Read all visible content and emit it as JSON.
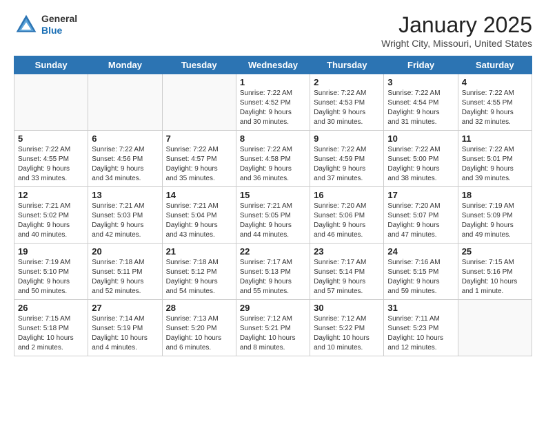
{
  "header": {
    "logo": {
      "general": "General",
      "blue": "Blue"
    },
    "title": "January 2025",
    "subtitle": "Wright City, Missouri, United States"
  },
  "weekdays": [
    "Sunday",
    "Monday",
    "Tuesday",
    "Wednesday",
    "Thursday",
    "Friday",
    "Saturday"
  ],
  "weeks": [
    [
      {
        "date": "",
        "info": ""
      },
      {
        "date": "",
        "info": ""
      },
      {
        "date": "",
        "info": ""
      },
      {
        "date": "1",
        "info": "Sunrise: 7:22 AM\nSunset: 4:52 PM\nDaylight: 9 hours\nand 30 minutes."
      },
      {
        "date": "2",
        "info": "Sunrise: 7:22 AM\nSunset: 4:53 PM\nDaylight: 9 hours\nand 30 minutes."
      },
      {
        "date": "3",
        "info": "Sunrise: 7:22 AM\nSunset: 4:54 PM\nDaylight: 9 hours\nand 31 minutes."
      },
      {
        "date": "4",
        "info": "Sunrise: 7:22 AM\nSunset: 4:55 PM\nDaylight: 9 hours\nand 32 minutes."
      }
    ],
    [
      {
        "date": "5",
        "info": "Sunrise: 7:22 AM\nSunset: 4:55 PM\nDaylight: 9 hours\nand 33 minutes."
      },
      {
        "date": "6",
        "info": "Sunrise: 7:22 AM\nSunset: 4:56 PM\nDaylight: 9 hours\nand 34 minutes."
      },
      {
        "date": "7",
        "info": "Sunrise: 7:22 AM\nSunset: 4:57 PM\nDaylight: 9 hours\nand 35 minutes."
      },
      {
        "date": "8",
        "info": "Sunrise: 7:22 AM\nSunset: 4:58 PM\nDaylight: 9 hours\nand 36 minutes."
      },
      {
        "date": "9",
        "info": "Sunrise: 7:22 AM\nSunset: 4:59 PM\nDaylight: 9 hours\nand 37 minutes."
      },
      {
        "date": "10",
        "info": "Sunrise: 7:22 AM\nSunset: 5:00 PM\nDaylight: 9 hours\nand 38 minutes."
      },
      {
        "date": "11",
        "info": "Sunrise: 7:22 AM\nSunset: 5:01 PM\nDaylight: 9 hours\nand 39 minutes."
      }
    ],
    [
      {
        "date": "12",
        "info": "Sunrise: 7:21 AM\nSunset: 5:02 PM\nDaylight: 9 hours\nand 40 minutes."
      },
      {
        "date": "13",
        "info": "Sunrise: 7:21 AM\nSunset: 5:03 PM\nDaylight: 9 hours\nand 42 minutes."
      },
      {
        "date": "14",
        "info": "Sunrise: 7:21 AM\nSunset: 5:04 PM\nDaylight: 9 hours\nand 43 minutes."
      },
      {
        "date": "15",
        "info": "Sunrise: 7:21 AM\nSunset: 5:05 PM\nDaylight: 9 hours\nand 44 minutes."
      },
      {
        "date": "16",
        "info": "Sunrise: 7:20 AM\nSunset: 5:06 PM\nDaylight: 9 hours\nand 46 minutes."
      },
      {
        "date": "17",
        "info": "Sunrise: 7:20 AM\nSunset: 5:07 PM\nDaylight: 9 hours\nand 47 minutes."
      },
      {
        "date": "18",
        "info": "Sunrise: 7:19 AM\nSunset: 5:09 PM\nDaylight: 9 hours\nand 49 minutes."
      }
    ],
    [
      {
        "date": "19",
        "info": "Sunrise: 7:19 AM\nSunset: 5:10 PM\nDaylight: 9 hours\nand 50 minutes."
      },
      {
        "date": "20",
        "info": "Sunrise: 7:18 AM\nSunset: 5:11 PM\nDaylight: 9 hours\nand 52 minutes."
      },
      {
        "date": "21",
        "info": "Sunrise: 7:18 AM\nSunset: 5:12 PM\nDaylight: 9 hours\nand 54 minutes."
      },
      {
        "date": "22",
        "info": "Sunrise: 7:17 AM\nSunset: 5:13 PM\nDaylight: 9 hours\nand 55 minutes."
      },
      {
        "date": "23",
        "info": "Sunrise: 7:17 AM\nSunset: 5:14 PM\nDaylight: 9 hours\nand 57 minutes."
      },
      {
        "date": "24",
        "info": "Sunrise: 7:16 AM\nSunset: 5:15 PM\nDaylight: 9 hours\nand 59 minutes."
      },
      {
        "date": "25",
        "info": "Sunrise: 7:15 AM\nSunset: 5:16 PM\nDaylight: 10 hours\nand 1 minute."
      }
    ],
    [
      {
        "date": "26",
        "info": "Sunrise: 7:15 AM\nSunset: 5:18 PM\nDaylight: 10 hours\nand 2 minutes."
      },
      {
        "date": "27",
        "info": "Sunrise: 7:14 AM\nSunset: 5:19 PM\nDaylight: 10 hours\nand 4 minutes."
      },
      {
        "date": "28",
        "info": "Sunrise: 7:13 AM\nSunset: 5:20 PM\nDaylight: 10 hours\nand 6 minutes."
      },
      {
        "date": "29",
        "info": "Sunrise: 7:12 AM\nSunset: 5:21 PM\nDaylight: 10 hours\nand 8 minutes."
      },
      {
        "date": "30",
        "info": "Sunrise: 7:12 AM\nSunset: 5:22 PM\nDaylight: 10 hours\nand 10 minutes."
      },
      {
        "date": "31",
        "info": "Sunrise: 7:11 AM\nSunset: 5:23 PM\nDaylight: 10 hours\nand 12 minutes."
      },
      {
        "date": "",
        "info": ""
      }
    ]
  ]
}
